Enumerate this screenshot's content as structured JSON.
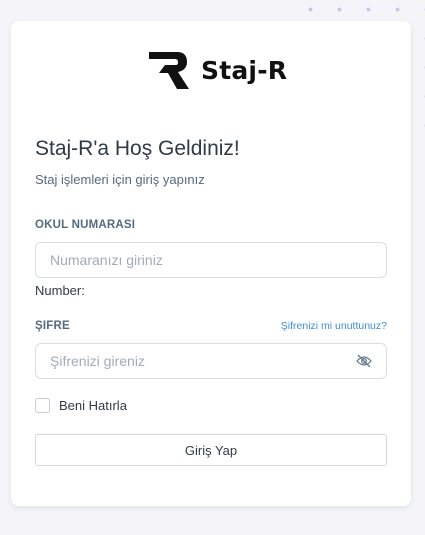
{
  "brand": {
    "name": "Staj-R",
    "logo_icon": "r-monogram-logo"
  },
  "welcome": {
    "title": "Staj-R'a Hoş Geldiniz!",
    "subtitle": "Staj işlemleri için giriş yapınız"
  },
  "student_number": {
    "label": "OKUL NUMARASI",
    "placeholder": "Numaranızı giriniz",
    "value": "",
    "hint": "Number:"
  },
  "password": {
    "label": "ŞIFRE",
    "forgot_link": "Şifrenizi mi unuttunuz?",
    "placeholder": "Şifrenizi gireniz",
    "value": "",
    "toggle_icon": "eye-off-icon"
  },
  "remember_me": {
    "label": "Beni Hatırla",
    "checked": false
  },
  "submit": {
    "label": "Giriş Yap"
  },
  "colors": {
    "background": "#f5f5f9",
    "card": "#ffffff",
    "link": "#3d8fd8",
    "text": "#566a7f",
    "decor_dots": "#c9c3ee"
  }
}
